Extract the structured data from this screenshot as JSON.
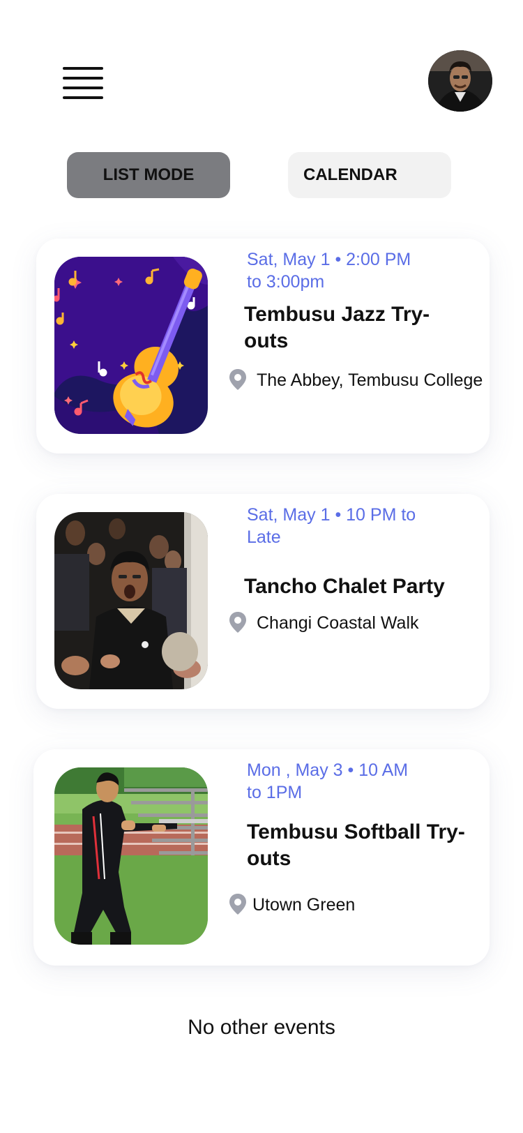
{
  "header": {
    "menu_icon": "hamburger-menu-icon",
    "avatar_icon": "user-avatar-photo"
  },
  "modes": {
    "list_label": "LIST MODE",
    "calendar_label": "CALENDAR",
    "active": "list"
  },
  "events": [
    {
      "date": "Sat, May 1 • 2:00 PM to 3:00pm",
      "title": "Tembusu Jazz Try-outs",
      "location": "The Abbey, Tembusu College",
      "image": "cello-illustration"
    },
    {
      "date": "Sat, May 1 • 10 PM to Late",
      "title": "Tancho Chalet Party",
      "location": "Changi Coastal Walk",
      "image": "party-crowd-photo"
    },
    {
      "date": "Mon , May 3 • 10 AM to 1PM",
      "title": "Tembusu Softball Try-outs",
      "location": "Utown Green",
      "image": "softball-player-photo"
    }
  ],
  "footer_note": "No other events",
  "colors": {
    "accent": "#5a6de6",
    "active_tab": "#7b7c80",
    "inactive_tab": "#f2f2f2",
    "pin": "#9fa2ad"
  }
}
